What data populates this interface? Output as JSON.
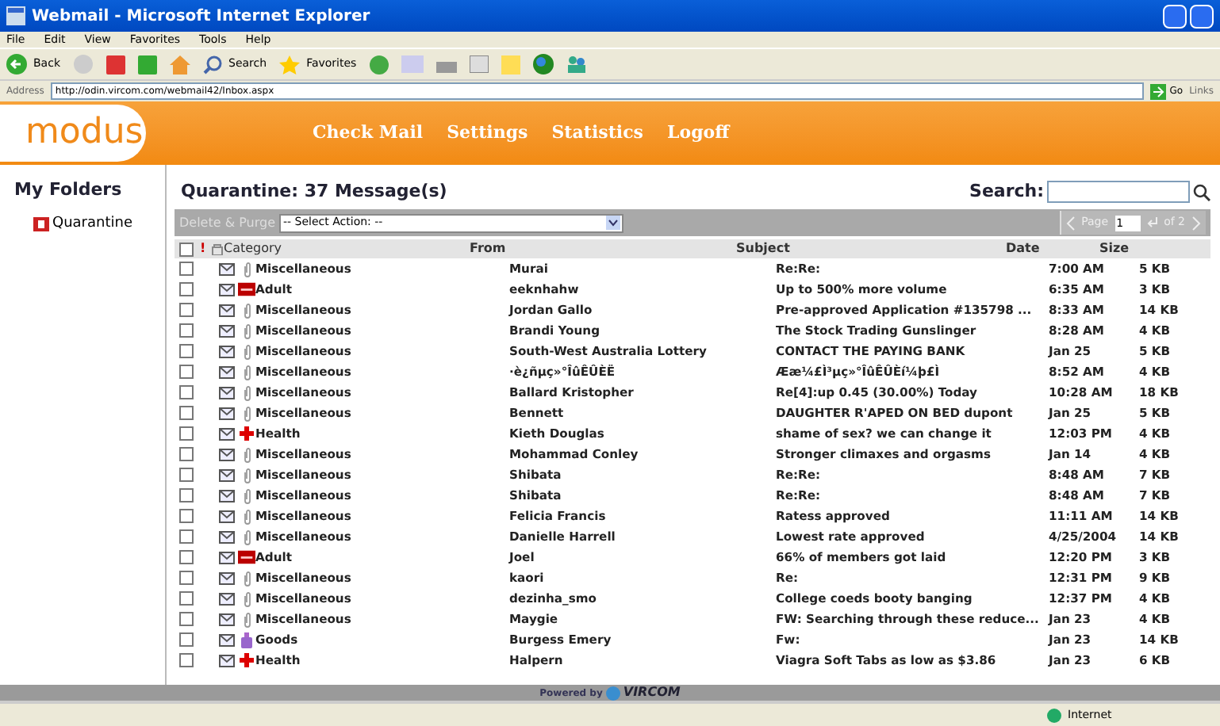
{
  "window": {
    "title": "Webmail - Microsoft Internet Explorer"
  },
  "menu": [
    "File",
    "Edit",
    "View",
    "Favorites",
    "Tools",
    "Help"
  ],
  "toolbar": {
    "back": "Back",
    "search": "Search",
    "favorites": "Favorites"
  },
  "address": {
    "label": "Address",
    "url": "http://odin.vircom.com/webmail42/Inbox.aspx",
    "go": "Go",
    "links": "Links"
  },
  "header": {
    "logo": "modus",
    "nav": [
      "Check Mail",
      "Settings",
      "Statistics",
      "Logoff"
    ]
  },
  "sidebar": {
    "title": "My Folders",
    "folders": [
      "Quarantine"
    ]
  },
  "main": {
    "title": "Quarantine: 37 Message(s)",
    "search_label": "Search:",
    "action_button": "Delete & Purge",
    "action_select": "-- Select Action: --",
    "pager": {
      "label": "Page",
      "value": "1",
      "total": "of 2"
    }
  },
  "table": {
    "select_all_checked": false,
    "priority_mark": "!",
    "columns": [
      "Category",
      "From",
      "Subject",
      "Date",
      "Size"
    ],
    "rows": [
      {
        "checked": false,
        "kind": "misc",
        "category": "Miscellaneous",
        "from": "Murai",
        "subject": "Re:Re:",
        "date": "7:00 AM",
        "size": "5 KB"
      },
      {
        "checked": false,
        "kind": "adult",
        "category": "Adult",
        "from": "eeknhahw",
        "subject": "Up to 500% more volume",
        "date": "6:35 AM",
        "size": "3 KB"
      },
      {
        "checked": false,
        "kind": "misc",
        "category": "Miscellaneous",
        "from": "Jordan Gallo",
        "subject": "Pre-approved Application #135798 ...",
        "date": "8:33 AM",
        "size": "14 KB"
      },
      {
        "checked": false,
        "kind": "misc",
        "category": "Miscellaneous",
        "from": "Brandi Young",
        "subject": "The Stock Trading Gunslinger",
        "date": "8:28 AM",
        "size": "4 KB"
      },
      {
        "checked": false,
        "kind": "misc",
        "category": "Miscellaneous",
        "from": "South-West Australia Lottery",
        "subject": "CONTACT THE PAYING BANK",
        "date": "Jan 25",
        "size": "5 KB"
      },
      {
        "checked": false,
        "kind": "misc",
        "category": "Miscellaneous",
        "from": "·è¿ñµç»°ÎûÊÛÈË",
        "subject": "Ææ¼£Ì³µç»°ÎûÊÛÈí¼þ£Ì",
        "date": "8:52 AM",
        "size": "4 KB"
      },
      {
        "checked": false,
        "kind": "misc",
        "category": "Miscellaneous",
        "from": "Ballard Kristopher",
        "subject": "Re[4]:up 0.45 (30.00%) Today",
        "date": "10:28 AM",
        "size": "18 KB"
      },
      {
        "checked": false,
        "kind": "misc",
        "category": "Miscellaneous",
        "from": "Bennett",
        "subject": "DAUGHTER R'APED ON BED dupont",
        "date": "Jan 25",
        "size": "5 KB"
      },
      {
        "checked": false,
        "kind": "health",
        "category": "Health",
        "from": "Kieth Douglas",
        "subject": "shame of sex? we can change it",
        "date": "12:03 PM",
        "size": "4 KB"
      },
      {
        "checked": false,
        "kind": "misc",
        "category": "Miscellaneous",
        "from": "Mohammad Conley",
        "subject": "Stronger climaxes and orgasms",
        "date": "Jan 14",
        "size": "4 KB"
      },
      {
        "checked": false,
        "kind": "misc",
        "category": "Miscellaneous",
        "from": "Shibata",
        "subject": "Re:Re:",
        "date": "8:48 AM",
        "size": "7 KB"
      },
      {
        "checked": false,
        "kind": "misc",
        "category": "Miscellaneous",
        "from": "Shibata",
        "subject": "Re:Re:",
        "date": "8:48 AM",
        "size": "7 KB"
      },
      {
        "checked": false,
        "kind": "misc",
        "category": "Miscellaneous",
        "from": "Felicia Francis",
        "subject": "Ratess approved",
        "date": "11:11 AM",
        "size": "14 KB"
      },
      {
        "checked": false,
        "kind": "misc",
        "category": "Miscellaneous",
        "from": "Danielle Harrell",
        "subject": "Lowest rate approved",
        "date": "4/25/2004",
        "size": "14 KB"
      },
      {
        "checked": false,
        "kind": "adult",
        "category": "Adult",
        "from": "Joel",
        "subject": "66% of members got laid",
        "date": "12:20 PM",
        "size": "3 KB"
      },
      {
        "checked": false,
        "kind": "misc",
        "category": "Miscellaneous",
        "from": "kaori",
        "subject": "Re:",
        "date": "12:31 PM",
        "size": "9 KB"
      },
      {
        "checked": false,
        "kind": "misc",
        "category": "Miscellaneous",
        "from": "dezinha_smo",
        "subject": "College coeds booty banging",
        "date": "12:37 PM",
        "size": "4 KB"
      },
      {
        "checked": false,
        "kind": "misc",
        "category": "Miscellaneous",
        "from": "Maygie",
        "subject": "FW: Searching through these reduce...",
        "date": "Jan 23",
        "size": "4 KB"
      },
      {
        "checked": false,
        "kind": "goods",
        "category": "Goods",
        "from": "Burgess Emery",
        "subject": "Fw:",
        "date": "Jan 23",
        "size": "14 KB"
      },
      {
        "checked": false,
        "kind": "health",
        "category": "Health",
        "from": "Halpern",
        "subject": "Viagra Soft Tabs as low as $3.86",
        "date": "Jan 23",
        "size": "6 KB"
      }
    ]
  },
  "footer": {
    "powered": "Powered by",
    "brand": "VIRCOM"
  },
  "status_bar": {
    "zone": "Internet"
  }
}
